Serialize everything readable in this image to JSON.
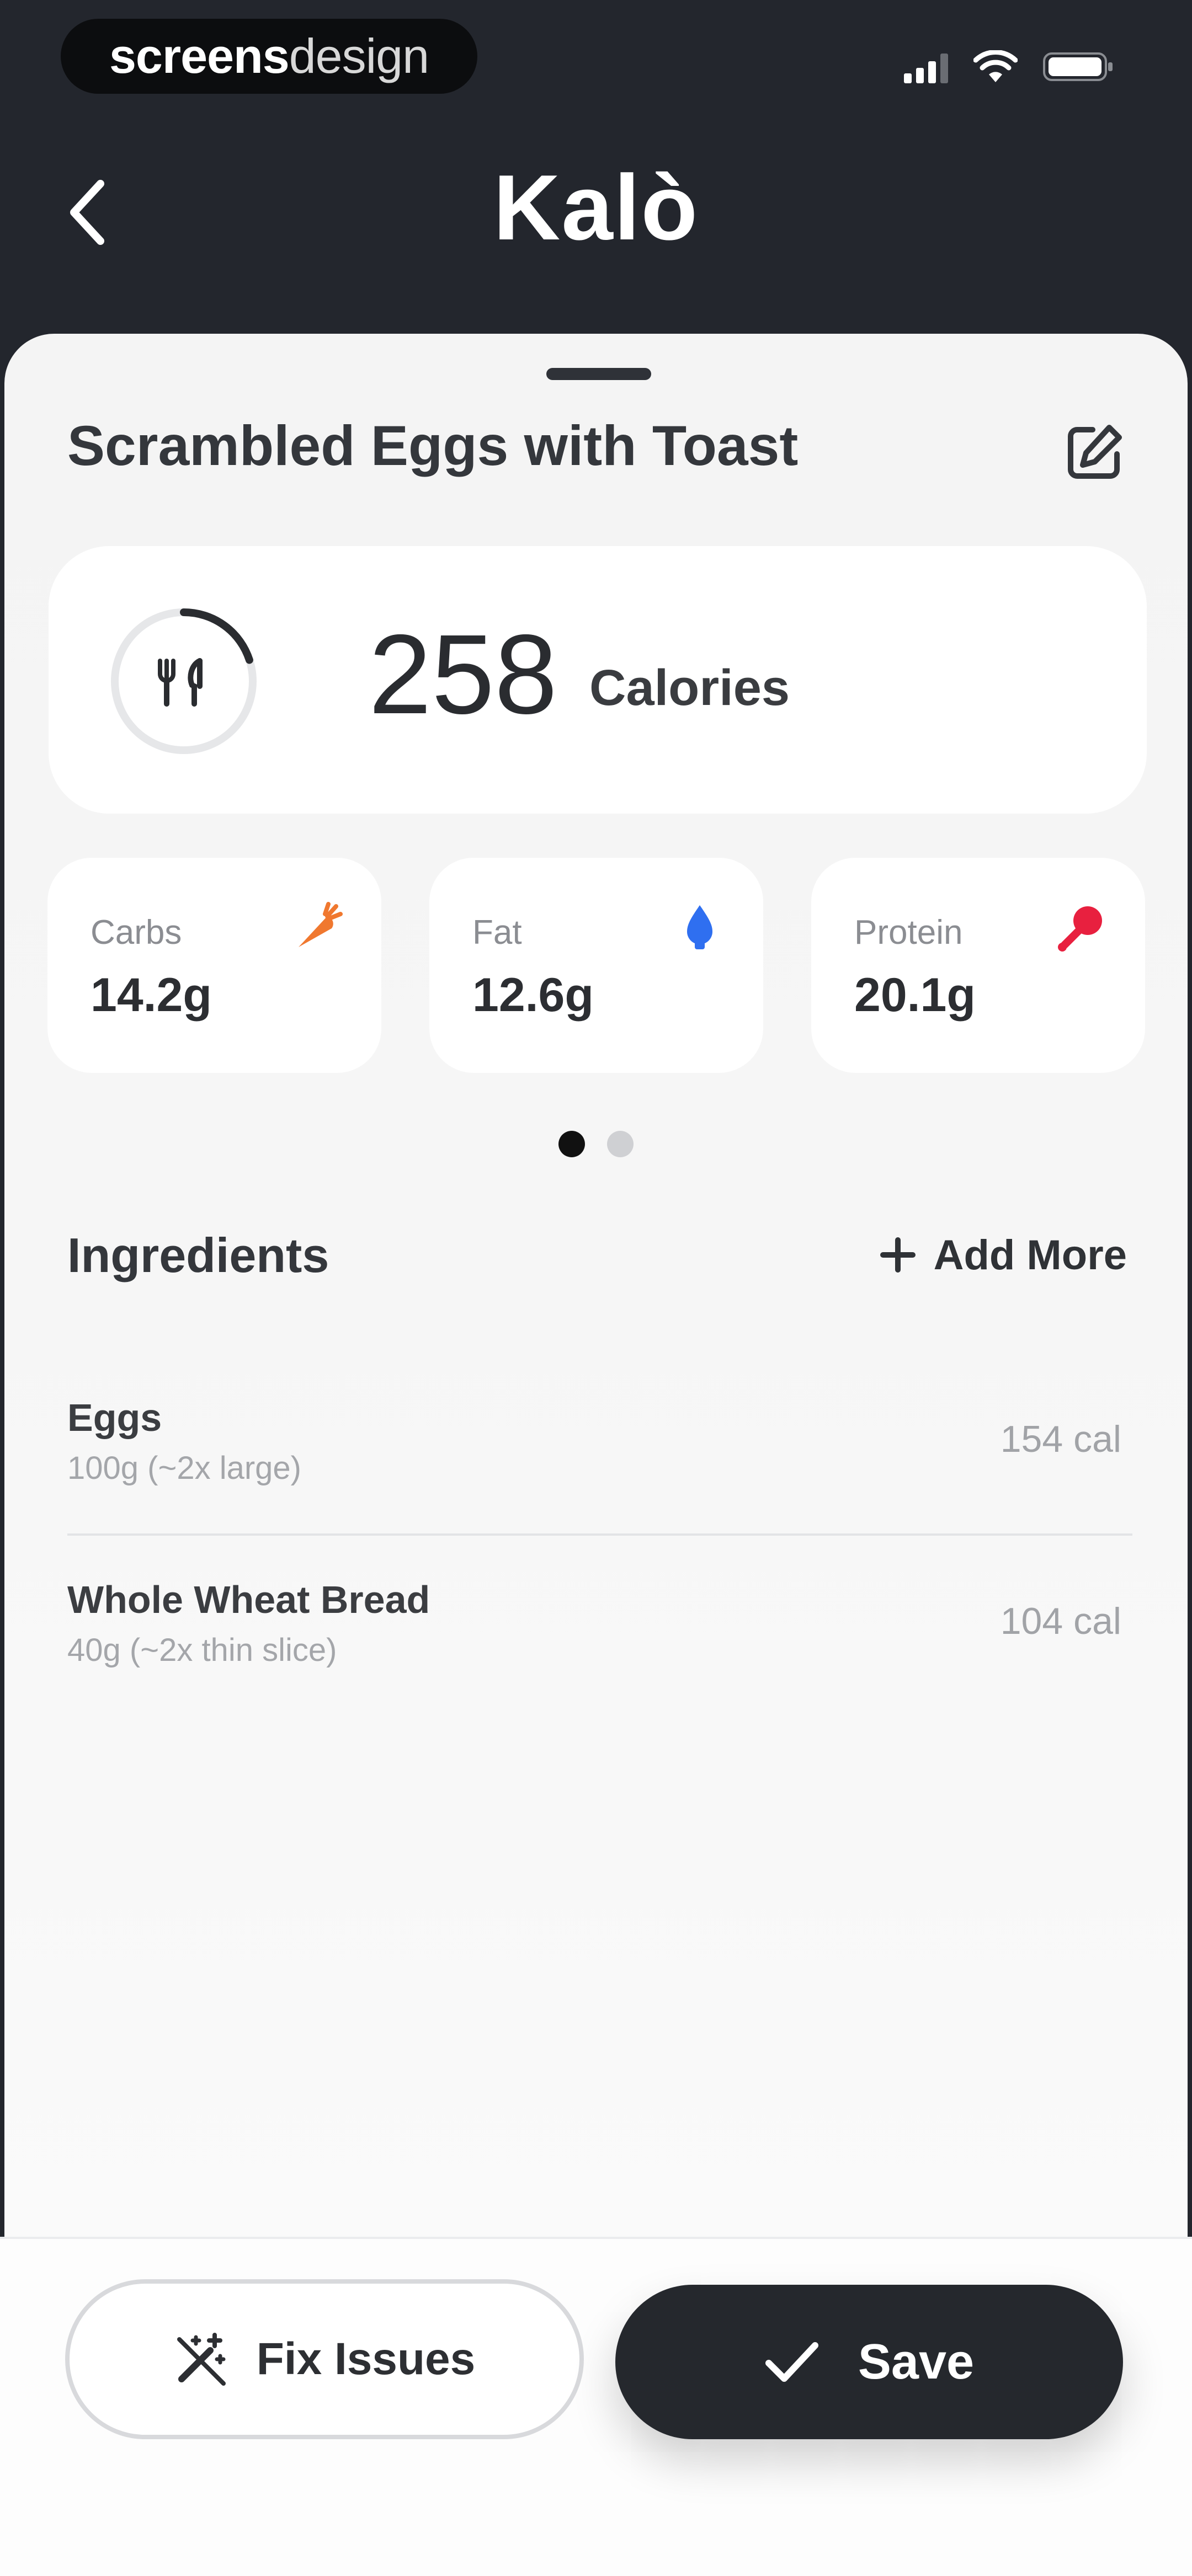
{
  "status_bar": {
    "brand_bold": "screens",
    "brand_light": "design"
  },
  "header": {
    "title": "Kalò"
  },
  "meal": {
    "title": "Scrambled Eggs with Toast"
  },
  "calories": {
    "value": "258",
    "label": "Calories",
    "ring_progress": 0.2
  },
  "macros": [
    {
      "label": "Carbs",
      "value": "14.2g",
      "icon": "carrot-icon",
      "color": "#f0782f"
    },
    {
      "label": "Fat",
      "value": "12.6g",
      "icon": "drop-icon",
      "color": "#2f6ff0"
    },
    {
      "label": "Protein",
      "value": "20.1g",
      "icon": "drumstick-icon",
      "color": "#e8203f"
    }
  ],
  "pager": {
    "pages": 2,
    "active": 0
  },
  "ingredients": {
    "heading": "Ingredients",
    "add_label": "Add More",
    "items": [
      {
        "name": "Eggs",
        "detail": "100g (~2x large)",
        "calories": "154 cal"
      },
      {
        "name": "Whole Wheat Bread",
        "detail": "40g (~2x thin slice)",
        "calories": "104 cal"
      }
    ]
  },
  "actions": {
    "fix_label": "Fix Issues",
    "save_label": "Save"
  }
}
